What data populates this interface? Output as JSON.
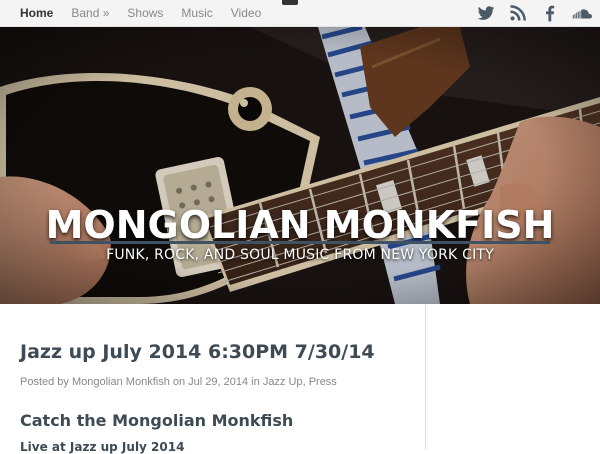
{
  "nav": {
    "items": [
      {
        "label": "Home",
        "active": true
      },
      {
        "label": "Band »",
        "active": false
      },
      {
        "label": "Shows",
        "active": false
      },
      {
        "label": "Music",
        "active": false
      },
      {
        "label": "Video",
        "active": false
      }
    ]
  },
  "social": {
    "icons": [
      "twitter-icon",
      "rss-icon",
      "facebook-icon",
      "soundcloud-icon"
    ]
  },
  "hero": {
    "title": "MONGOLIAN MONKFISH",
    "tagline": "FUNK, ROCK, AND SOUL MUSIC FROM NEW YORK CITY"
  },
  "post": {
    "title": "Jazz up July 2014 6:30PM 7/30/14",
    "meta_prefix": "Posted by",
    "author": "Mongolian Monkfish",
    "meta_on": "on Jul 29, 2014 in",
    "cat1": "Jazz Up",
    "cat_sep": ",",
    "cat2": "Press",
    "subheading": "Catch the Mongolian Monkfish",
    "subheading2": "Live at Jazz up July 2014"
  },
  "colors": {
    "heading": "#3e4a54",
    "accent_rule": "#3e5263",
    "nav_bg": "#f4f4f4"
  }
}
